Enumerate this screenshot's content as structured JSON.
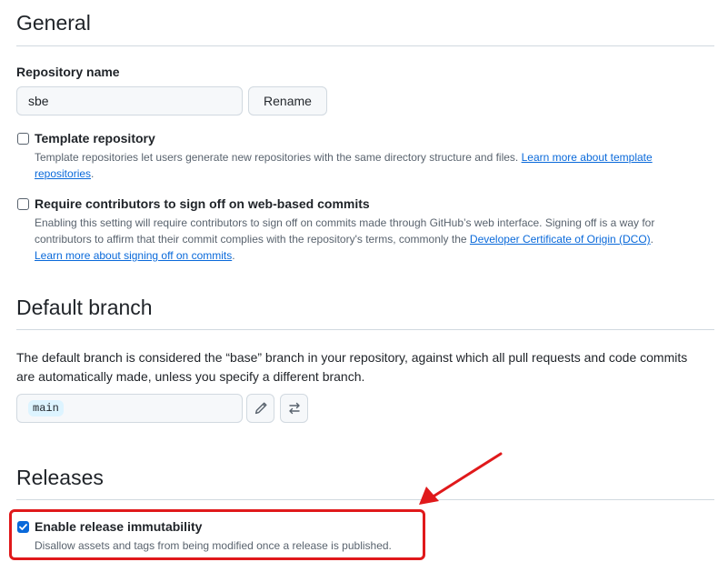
{
  "general": {
    "title": "General",
    "repo_name_label": "Repository name",
    "repo_name_value": "sbe",
    "rename_label": "Rename",
    "template": {
      "title": "Template repository",
      "desc": "Template repositories let users generate new repositories with the same directory structure and files.",
      "link": "Learn more about template repositories",
      "trailing": ".",
      "checked": false
    },
    "signoff": {
      "title": "Require contributors to sign off on web-based commits",
      "desc": "Enabling this setting will require contributors to sign off on commits made through GitHub’s web interface. Signing off is a way for contributors to affirm that their commit complies with the repository's terms, commonly the",
      "link1": "Developer Certificate of Origin (DCO)",
      "mid": ".",
      "link2": "Learn more about signing off on commits",
      "trailing": ".",
      "checked": false
    }
  },
  "default_branch": {
    "title": "Default branch",
    "desc": "The default branch is considered the “base” branch in your repository, against which all pull requests and code commits are automatically made, unless you specify a different branch.",
    "branch_name": "main"
  },
  "releases": {
    "title": "Releases",
    "immutable": {
      "title": "Enable release immutability",
      "desc": "Disallow assets and tags from being modified once a release is published.",
      "checked": true
    }
  },
  "annotation": {
    "highlight_color": "#e0191b"
  },
  "icons": {
    "edit": "pencil-icon",
    "switch": "arrow-switch-icon",
    "arrow": "annotation-arrow-icon"
  }
}
